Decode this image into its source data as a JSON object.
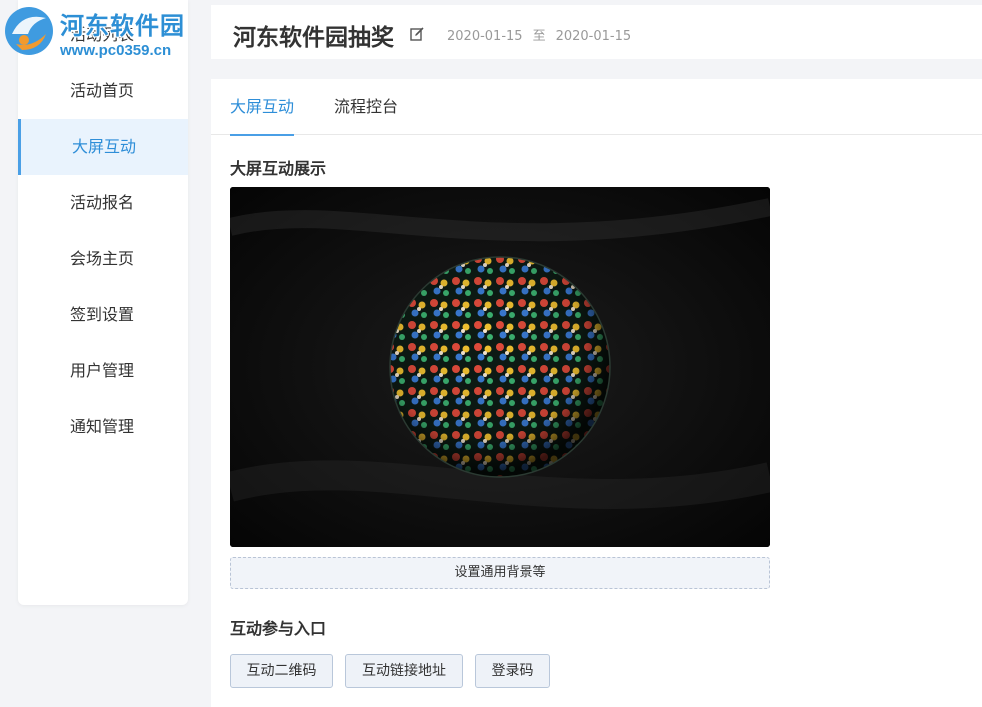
{
  "watermark": {
    "title": "河东软件园",
    "url": "www.pc0359.cn"
  },
  "sidebar": {
    "items": [
      {
        "label": "活动列表"
      },
      {
        "label": "活动首页"
      },
      {
        "label": "大屏互动",
        "active": true
      },
      {
        "label": "活动报名"
      },
      {
        "label": "会场主页"
      },
      {
        "label": "签到设置"
      },
      {
        "label": "用户管理"
      },
      {
        "label": "通知管理"
      }
    ]
  },
  "header": {
    "title": "河东软件园抽奖",
    "edit_icon": "edit-icon",
    "start_date": "2020-01-15",
    "separator": "至",
    "end_date": "2020-01-15"
  },
  "tabs": [
    {
      "label": "大屏互动",
      "active": true
    },
    {
      "label": "流程控台"
    }
  ],
  "display_section": {
    "title": "大屏互动展示",
    "background_button": "设置通用背景等"
  },
  "entry_section": {
    "title": "互动参与入口",
    "buttons": [
      "互动二维码",
      "互动链接地址",
      "登录码"
    ]
  },
  "colors": {
    "accent": "#2e8ed8",
    "active_bg": "#e9f3fd",
    "page_bg": "#f3f4f7"
  }
}
